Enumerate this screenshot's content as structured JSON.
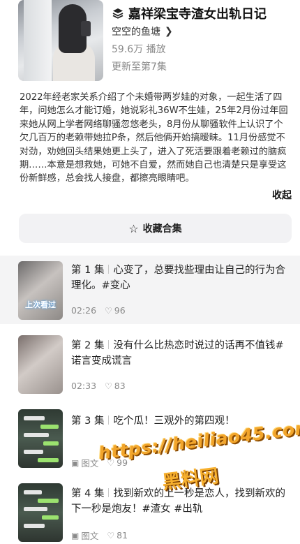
{
  "collection": {
    "title": "嘉祥梁宝寺渣女出轨日记",
    "author": "空空的鱼塘",
    "plays": "59.6万 播放",
    "updated": "更新至第7集",
    "description": "2022年经老家关系介绍了个未婚带两岁娃的对象，一起生活了四年，问她怎么才能订婚，她说彩礼36W不生娃，25年2月份过年回来她从网上学者网络聊骚忽悠老头，8月份从聊骚软件上认识了个欠几百万的老赖带她拉P条，然后他俩开始搞暧昧。11月份感觉不对劲，劝她回头结果她更上头了，进入了死活要跟着老赖过的脑疯期……本意是想救她，可她不自爱，然而她自己也清楚只是享受这份新鲜感，总会找人接盘，都擦亮眼睛吧。",
    "collapse_label": "收起",
    "favorite_label": "收藏合集"
  },
  "episodes": [
    {
      "num": "第 1 集",
      "text": "心变了，总要找些理由让自己的行为合理化。#变心",
      "meta_type": "duration",
      "duration": "02:26",
      "likes": "96",
      "overlay": "上次看过",
      "active": true
    },
    {
      "num": "第 2 集",
      "text": "没有什么比热恋时说过的话再不值钱#诺言变成谎言",
      "meta_type": "duration",
      "duration": "02:33",
      "likes": "83",
      "overlay": "",
      "active": false
    },
    {
      "num": "第 3 集",
      "text": "吃个瓜！三观外的第四观！",
      "meta_type": "图文",
      "duration": "",
      "likes": "99",
      "overlay": "",
      "active": false
    },
    {
      "num": "第 4 集",
      "text": "找到新欢的上一秒是恋人，找到新欢的下一秒是炮友！#渣女 #出轨",
      "meta_type": "图文",
      "duration": "",
      "likes": "81",
      "overlay": "",
      "active": false
    }
  ],
  "watermark": {
    "url": "https://heiliao45.com",
    "name": "黑料网"
  }
}
